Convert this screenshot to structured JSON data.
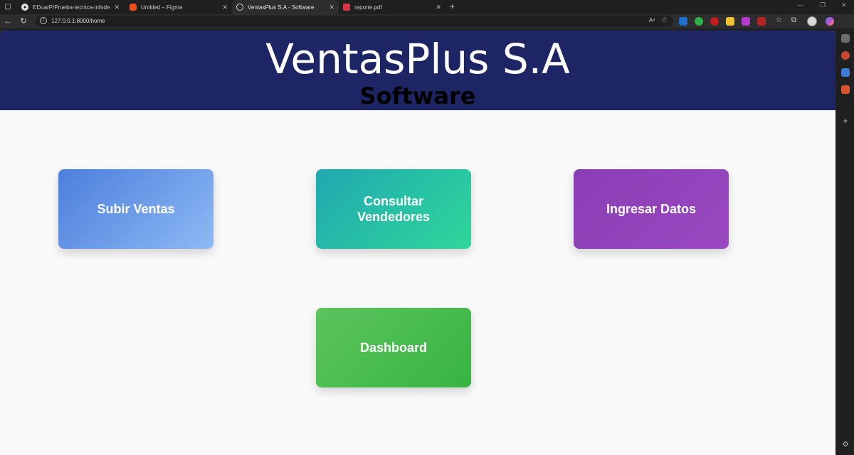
{
  "browser": {
    "tabs": [
      {
        "title": "EDuarP/Prueba-tecnica-infodec",
        "icon": "github-icon",
        "active": false
      },
      {
        "title": "Untitled – Figma",
        "icon": "figma-icon",
        "active": false
      },
      {
        "title": "VentasPlus S.A - Software",
        "icon": "globe-icon",
        "active": true
      },
      {
        "title": "reporte.pdf",
        "icon": "pdf-icon",
        "active": false
      }
    ],
    "url": "127.0.0.1:8000/home"
  },
  "site": {
    "title": "VentasPlus S.A",
    "subtitle": "Software",
    "header_color": "#1d2564"
  },
  "cards": [
    {
      "label": "Subir Ventas",
      "gradient": [
        "#4c7fdc",
        "#8db9f4"
      ]
    },
    {
      "label": "Consultar Vendedores",
      "gradient": [
        "#20a8b1",
        "#2fd79a"
      ]
    },
    {
      "label": "Ingresar Datos",
      "gradient": [
        "#8a3eb5",
        "#9a48c0"
      ]
    },
    {
      "label": "Dashboard",
      "gradient": [
        "#5cc45d",
        "#37b442"
      ]
    }
  ]
}
